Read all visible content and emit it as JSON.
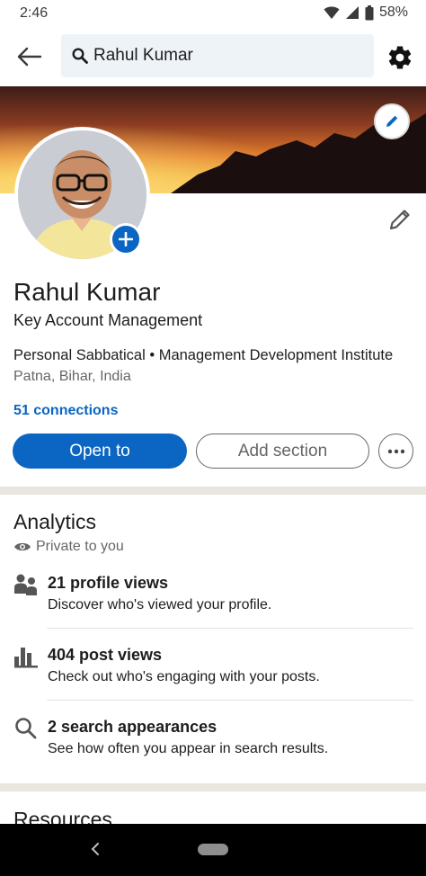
{
  "status": {
    "time": "2:46",
    "battery": "58%"
  },
  "search": {
    "value": "Rahul Kumar"
  },
  "profile": {
    "name": "Rahul Kumar",
    "headline": "Key Account Management",
    "experience": "Personal Sabbatical • Management Development Institute",
    "location": "Patna, Bihar, India",
    "connections": "51 connections"
  },
  "actions": {
    "open_to": "Open to",
    "add_section": "Add section"
  },
  "analytics": {
    "title": "Analytics",
    "privacy": "Private to you",
    "items": [
      {
        "icon": "people-icon",
        "title": "21 profile views",
        "desc": "Discover who's viewed your profile."
      },
      {
        "icon": "bar-chart-icon",
        "title": "404 post views",
        "desc": "Check out who's engaging with your posts."
      },
      {
        "icon": "search-icon",
        "title": "2 search appearances",
        "desc": "See how often you appear in search results."
      }
    ]
  },
  "resources": {
    "title": "Resources"
  },
  "colors": {
    "accent": "#0a66c2",
    "band": "#e9e5df"
  }
}
